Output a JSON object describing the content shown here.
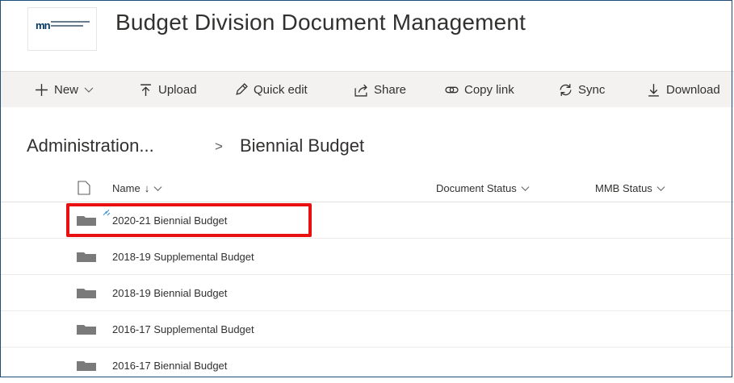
{
  "header": {
    "site_title": "Budget Division Document Management",
    "logo_text": "mn MANAGEMENT AND BUDGET"
  },
  "commands": [
    {
      "label": "New",
      "icon": "plus-icon",
      "has_dropdown": true
    },
    {
      "label": "Upload",
      "icon": "upload-icon"
    },
    {
      "label": "Quick edit",
      "icon": "pencil-icon"
    },
    {
      "label": "Share",
      "icon": "share-icon"
    },
    {
      "label": "Copy link",
      "icon": "link-icon"
    },
    {
      "label": "Sync",
      "icon": "sync-icon"
    },
    {
      "label": "Download",
      "icon": "download-icon"
    }
  ],
  "breadcrumb": {
    "parent": "Administration...",
    "separator": ">",
    "current": "Biennial Budget"
  },
  "columns": {
    "name": "Name",
    "name_sort": "↓",
    "document_status": "Document Status",
    "mmb_status": "MMB Status"
  },
  "rows": [
    {
      "name": "2020-21 Biennial Budget",
      "is_new": true,
      "highlighted": true
    },
    {
      "name": "2018-19 Supplemental Budget"
    },
    {
      "name": "2018-19 Biennial Budget"
    },
    {
      "name": "2016-17 Supplemental Budget"
    },
    {
      "name": "2016-17 Biennial Budget"
    }
  ],
  "colors": {
    "highlight": "#e81010",
    "folder": "#7a7a7a",
    "command_bar": "#f3f2f1",
    "brand": "#003865"
  }
}
